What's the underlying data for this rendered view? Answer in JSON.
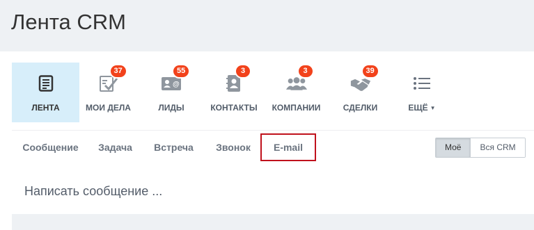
{
  "page": {
    "title": "Лента CRM"
  },
  "nav": {
    "items": [
      {
        "label": "ЛЕНТА",
        "icon": "feed-icon",
        "active": true,
        "badge": ""
      },
      {
        "label": "МОИ ДЕЛА",
        "icon": "tasks-check-icon",
        "active": false,
        "badge": "37"
      },
      {
        "label": "ЛИДЫ",
        "icon": "lead-card-icon",
        "active": false,
        "badge": "55"
      },
      {
        "label": "КОНТАКТЫ",
        "icon": "address-book-icon",
        "active": false,
        "badge": "3"
      },
      {
        "label": "КОМПАНИИ",
        "icon": "people-group-icon",
        "active": false,
        "badge": "3"
      },
      {
        "label": "СДЕЛКИ",
        "icon": "handshake-icon",
        "active": false,
        "badge": "39"
      },
      {
        "label": "ЕЩЁ",
        "icon": "list-menu-icon",
        "active": false,
        "badge": ""
      }
    ]
  },
  "tabs": {
    "items": [
      "Сообщение",
      "Задача",
      "Встреча",
      "Звонок",
      "E-mail"
    ],
    "highlighted": "E-mail"
  },
  "scope_switch": {
    "mine": "Моё",
    "all": "Вся CRM",
    "selected": "Моё"
  },
  "composer": {
    "placeholder": "Написать сообщение ..."
  },
  "colors": {
    "accent": "#d7eefa",
    "badge": "#f2421b",
    "highlight_border": "#c0111c"
  }
}
